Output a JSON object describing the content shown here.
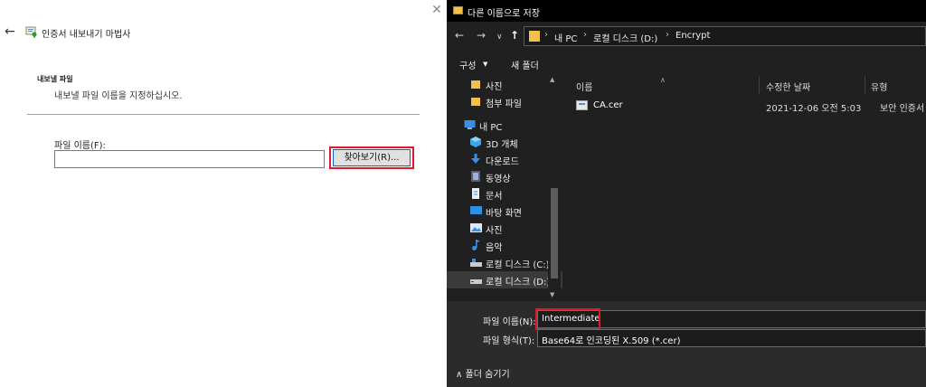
{
  "wizard": {
    "back_glyph": "←",
    "title": "인증서 내보내기 마법사",
    "close_glyph": "✕",
    "section_title": "내보낼 파일",
    "section_subtitle": "내보낼 파일 이름을 지정하십시오.",
    "filename_label": "파일 이름(F):",
    "filename_value": "",
    "browse_label": "찾아보기(R)...",
    "highlight_color": "#e0192a"
  },
  "dialog": {
    "title": "다른 이름으로 저장",
    "nav": {
      "back": "←",
      "forward": "→",
      "dropdown": "∨",
      "up": "↑"
    },
    "address": {
      "crumbs": [
        "내 PC",
        "로컬 디스크 (D:)",
        "Encrypt"
      ],
      "sep": "›"
    },
    "toolbar": {
      "organize": "구성",
      "organize_arrow": "▼",
      "new_folder": "새 폴더"
    },
    "nav_items": [
      {
        "label": "사진",
        "icon": "folder-icon"
      },
      {
        "label": "첨부 파일",
        "icon": "folder-icon"
      },
      {
        "label": "내 PC",
        "icon": "computer-icon"
      },
      {
        "label": "3D 개체",
        "icon": "3d-objects-icon"
      },
      {
        "label": "다운로드",
        "icon": "download-icon"
      },
      {
        "label": "동영상",
        "icon": "video-icon"
      },
      {
        "label": "문서",
        "icon": "document-icon"
      },
      {
        "label": "바탕 화면",
        "icon": "desktop-icon"
      },
      {
        "label": "사진",
        "icon": "pictures-icon"
      },
      {
        "label": "음악",
        "icon": "music-icon"
      },
      {
        "label": "로컬 디스크 (C:)",
        "icon": "drive-icon"
      },
      {
        "label": "로컬 디스크 (D:)",
        "icon": "drive-icon"
      }
    ],
    "columns": {
      "name": "이름",
      "date": "수정한 날짜",
      "type": "유형"
    },
    "files": [
      {
        "name": "CA.cer",
        "date": "2021-12-06 오전 5:03",
        "type": "보안 인증서"
      }
    ],
    "filename_label": "파일 이름(N):",
    "filename_value": "Intermediate",
    "filetype_label": "파일 형식(T):",
    "filetype_value": "Base64로 인코딩된 X.509 (*.cer)",
    "hide_folders": "∧ 폴더 숨기기"
  }
}
